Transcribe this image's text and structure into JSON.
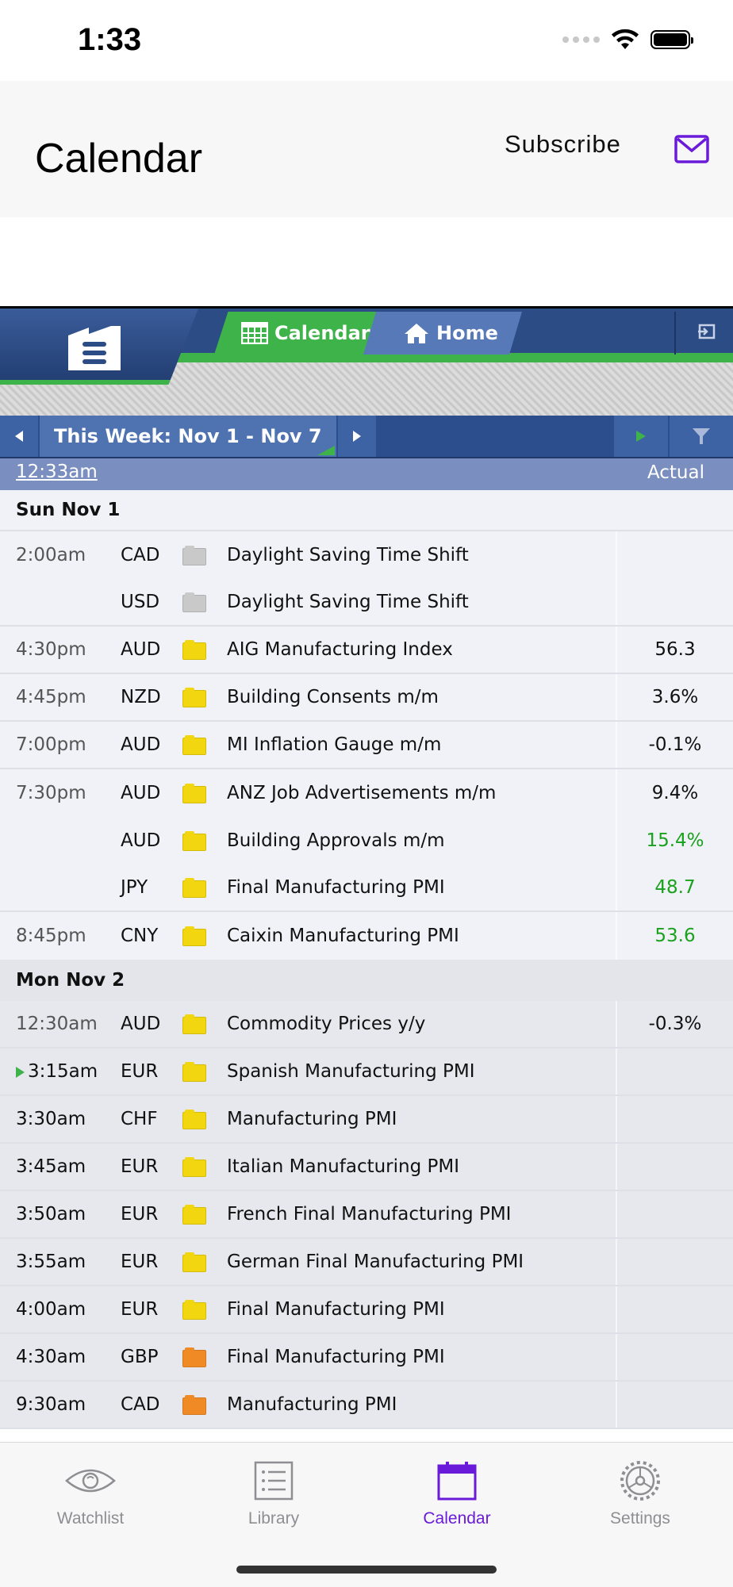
{
  "status_bar": {
    "time": "1:33"
  },
  "nav": {
    "title": "Calendar",
    "subscribe": "Subscribe"
  },
  "ff_header": {
    "tab_calendar": "Calendar",
    "tab_home": "Home"
  },
  "week_bar": {
    "label": "This Week: Nov 1 - Nov 7"
  },
  "columns": {
    "time": "12:33am",
    "actual": "Actual"
  },
  "colors": {
    "accent": "#6a1bd9",
    "ff_green": "#3eb34a",
    "ff_blue": "#2c4c85",
    "better": "#1aa11d",
    "impact_yellow": "#f2d60f",
    "impact_orange": "#f08a24",
    "impact_gray": "#c9c9c9"
  },
  "days": [
    {
      "label": "Sun Nov 1",
      "rows": [
        {
          "time": "2:00am",
          "currency": "CAD",
          "impact": "gray",
          "event": "Daylight Saving Time Shift",
          "actual": "",
          "gap": false
        },
        {
          "time": "",
          "currency": "USD",
          "impact": "gray",
          "event": "Daylight Saving Time Shift",
          "actual": "",
          "gap": true
        },
        {
          "time": "4:30pm",
          "currency": "AUD",
          "impact": "yellow",
          "event": "AIG Manufacturing Index",
          "actual": "56.3",
          "gap": true
        },
        {
          "time": "4:45pm",
          "currency": "NZD",
          "impact": "yellow",
          "event": "Building Consents m/m",
          "actual": "3.6%",
          "gap": true
        },
        {
          "time": "7:00pm",
          "currency": "AUD",
          "impact": "yellow",
          "event": "MI Inflation Gauge m/m",
          "actual": "-0.1%",
          "gap": true
        },
        {
          "time": "7:30pm",
          "currency": "AUD",
          "impact": "yellow",
          "event": "ANZ Job Advertisements m/m",
          "actual": "9.4%",
          "gap": false
        },
        {
          "time": "",
          "currency": "AUD",
          "impact": "yellow",
          "event": "Building Approvals m/m",
          "actual": "15.4%",
          "better": true,
          "gap": false
        },
        {
          "time": "",
          "currency": "JPY",
          "impact": "yellow",
          "event": "Final Manufacturing PMI",
          "actual": "48.7",
          "better": true,
          "gap": true
        },
        {
          "time": "8:45pm",
          "currency": "CNY",
          "impact": "yellow",
          "event": "Caixin Manufacturing PMI",
          "actual": "53.6",
          "better": true,
          "gap": false
        }
      ]
    },
    {
      "label": "Mon Nov 2",
      "rows": [
        {
          "time": "12:30am",
          "currency": "AUD",
          "impact": "yellow",
          "event": "Commodity Prices y/y",
          "actual": "-0.3%",
          "gap": true
        },
        {
          "time": "3:15am",
          "currency": "EUR",
          "impact": "yellow",
          "event": "Spanish Manufacturing PMI",
          "actual": "",
          "current": true,
          "gap": true
        },
        {
          "time": "3:30am",
          "currency": "CHF",
          "impact": "yellow",
          "event": "Manufacturing PMI",
          "actual": "",
          "gap": true
        },
        {
          "time": "3:45am",
          "currency": "EUR",
          "impact": "yellow",
          "event": "Italian Manufacturing PMI",
          "actual": "",
          "gap": true
        },
        {
          "time": "3:50am",
          "currency": "EUR",
          "impact": "yellow",
          "event": "French Final Manufacturing PMI",
          "actual": "",
          "gap": true
        },
        {
          "time": "3:55am",
          "currency": "EUR",
          "impact": "yellow",
          "event": "German Final Manufacturing PMI",
          "actual": "",
          "gap": true
        },
        {
          "time": "4:00am",
          "currency": "EUR",
          "impact": "yellow",
          "event": "Final Manufacturing PMI",
          "actual": "",
          "gap": true
        },
        {
          "time": "4:30am",
          "currency": "GBP",
          "impact": "orange",
          "event": "Final Manufacturing PMI",
          "actual": "",
          "gap": true
        },
        {
          "time": "9:30am",
          "currency": "CAD",
          "impact": "orange",
          "event": "Manufacturing PMI",
          "actual": "",
          "gap": true
        }
      ]
    }
  ],
  "tabs": [
    {
      "label": "Watchlist",
      "icon": "eye-icon"
    },
    {
      "label": "Library",
      "icon": "list-icon"
    },
    {
      "label": "Calendar",
      "icon": "calendar-icon",
      "active": true
    },
    {
      "label": "Settings",
      "icon": "gear-icon"
    }
  ]
}
